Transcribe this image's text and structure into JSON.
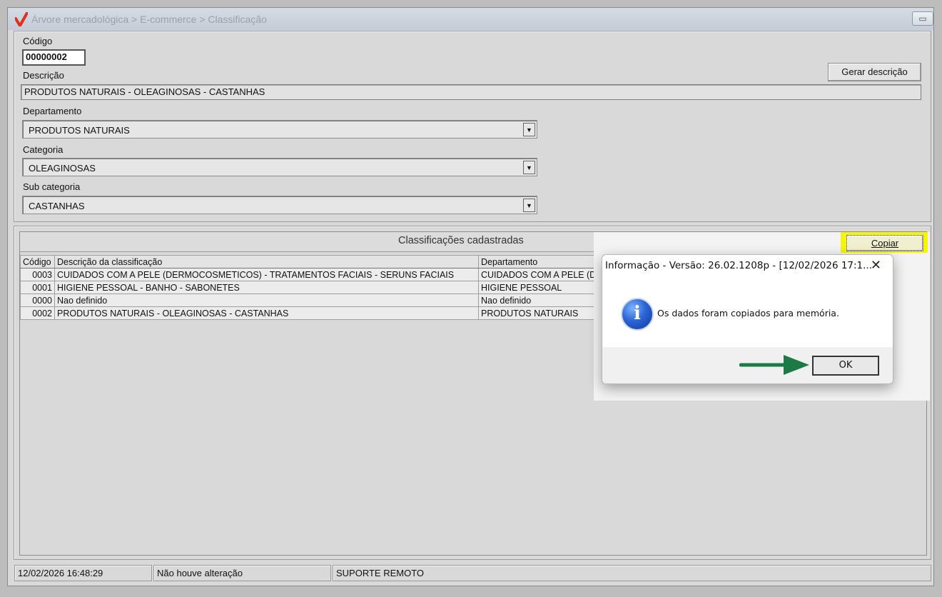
{
  "window": {
    "title": "Árvore mercadológica > E-commerce > Classificação",
    "restore_icon": "restore-window-icon"
  },
  "form": {
    "code_label": "Código",
    "code_value": "00000002",
    "description_label": "Descrição",
    "description_value": "PRODUTOS NATURAIS - OLEAGINOSAS - CASTANHAS",
    "generate_button": "Gerar descrição",
    "department_label": "Departamento",
    "department_value": "PRODUTOS NATURAIS",
    "category_label": "Categoria",
    "category_value": "OLEAGINOSAS",
    "subcategory_label": "Sub categoria",
    "subcategory_value": "CASTANHAS"
  },
  "grid": {
    "header": "Classificações cadastradas",
    "copy_button": "Copiar",
    "columns": [
      "Código",
      "Descrição da classificação",
      "Departamento"
    ],
    "rows": [
      {
        "code": "0003",
        "description": "CUIDADOS COM A PELE (DERMOCOSMETICOS) - TRATAMENTOS FACIAIS - SERUNS FACIAIS",
        "department": "CUIDADOS COM A PELE (D"
      },
      {
        "code": "0001",
        "description": "HIGIENE PESSOAL - BANHO - SABONETES",
        "department": "HIGIENE PESSOAL"
      },
      {
        "code": "0000",
        "description": "Nao definido",
        "department": "Nao definido"
      },
      {
        "code": "0002",
        "description": "PRODUTOS NATURAIS - OLEAGINOSAS - CASTANHAS",
        "department": "PRODUTOS NATURAIS"
      }
    ]
  },
  "dialog": {
    "title": "Informação - Versão: 26.02.1208p - [12/02/2026 17:1...",
    "message": "Os dados foram copiados para memória.",
    "ok_button": "OK",
    "icon": "info-icon"
  },
  "status": {
    "datetime": "12/02/2026 16:48:29",
    "change_state": "Não houve alteração",
    "user": "SUPORTE REMOTO"
  },
  "colors": {
    "highlight": "#f5f50a",
    "arrow": "#1e7a45",
    "logo": "#e0301e"
  }
}
